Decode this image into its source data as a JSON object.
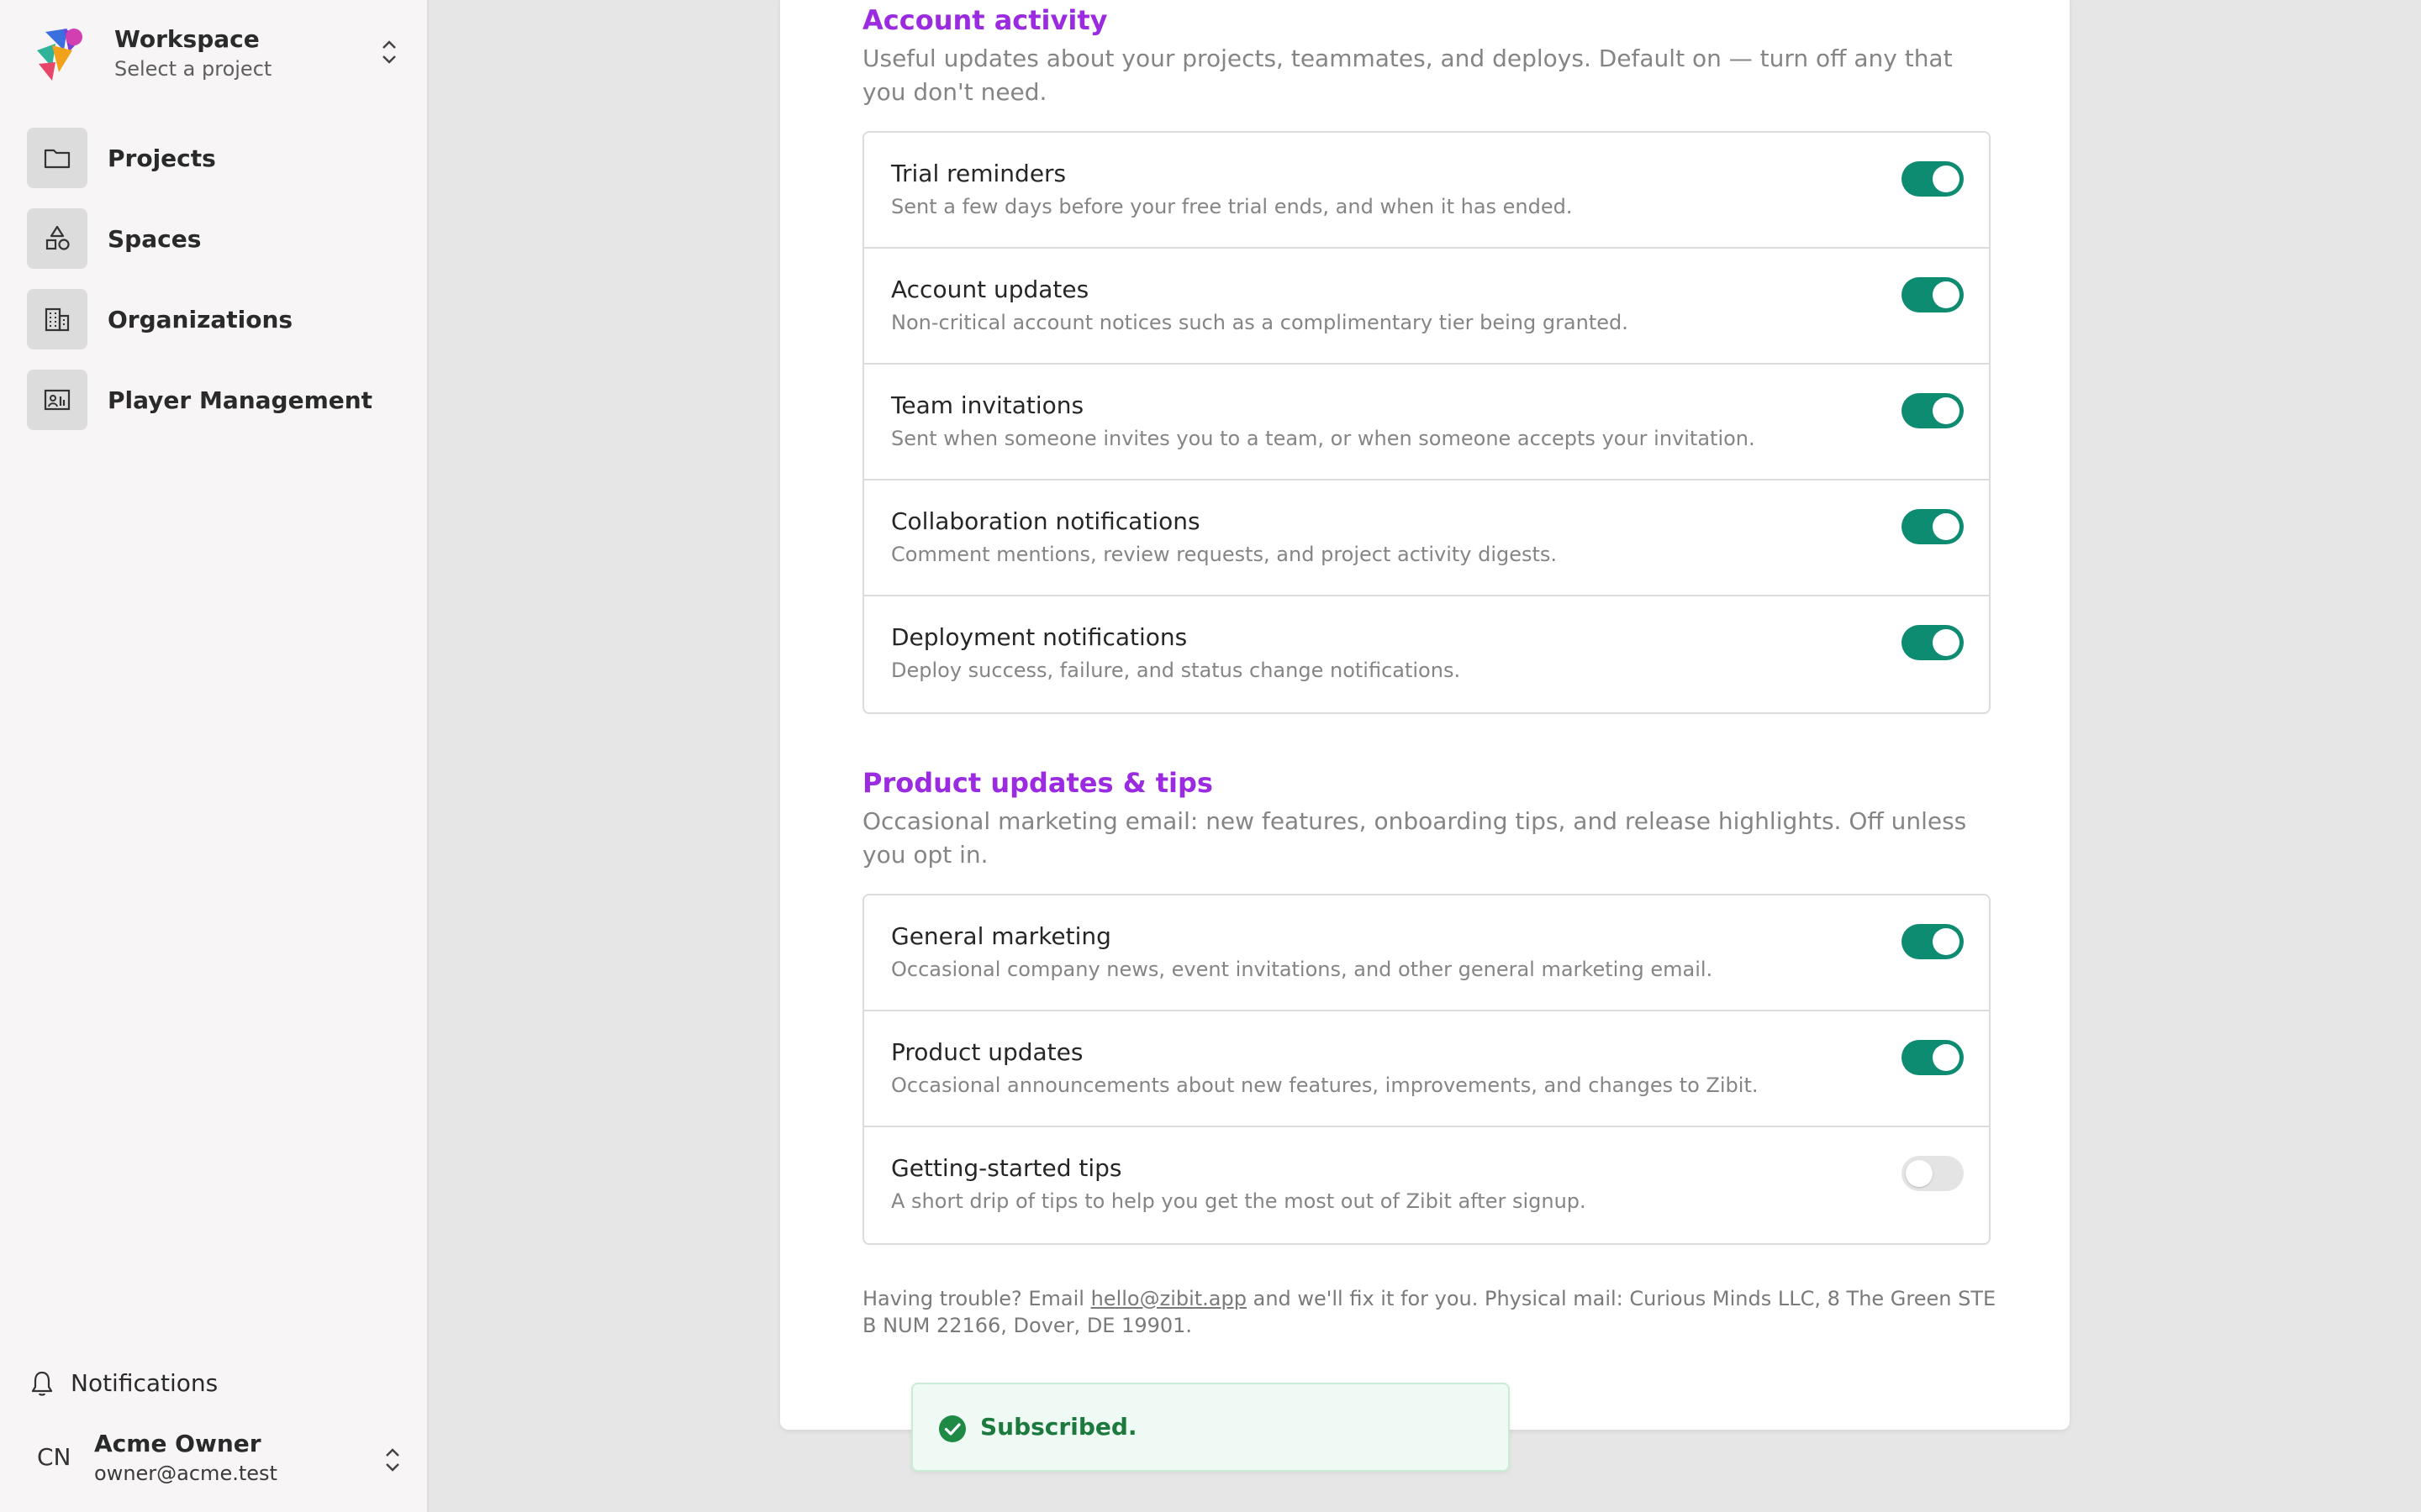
{
  "sidebar": {
    "workspace": {
      "name": "Workspace",
      "subtitle": "Select a project"
    },
    "nav": [
      {
        "label": "Projects",
        "icon": "folder-icon"
      },
      {
        "label": "Spaces",
        "icon": "shapes-icon"
      },
      {
        "label": "Organizations",
        "icon": "building-icon"
      },
      {
        "label": "Player Management",
        "icon": "player-icon"
      }
    ],
    "notifications_label": "Notifications",
    "user": {
      "initials": "CN",
      "name": "Acme Owner",
      "email": "owner@acme.test"
    }
  },
  "account_activity": {
    "title": "Account activity",
    "description": "Useful updates about your projects, teammates, and deploys. Default on — turn off any that you don't need.",
    "items": [
      {
        "title": "Trial reminders",
        "description": "Sent a few days before your free trial ends, and when it has ended.",
        "enabled": true
      },
      {
        "title": "Account updates",
        "description": "Non-critical account notices such as a complimentary tier being granted.",
        "enabled": true
      },
      {
        "title": "Team invitations",
        "description": "Sent when someone invites you to a team, or when someone accepts your invitation.",
        "enabled": true
      },
      {
        "title": "Collaboration notifications",
        "description": "Comment mentions, review requests, and project activity digests.",
        "enabled": true
      },
      {
        "title": "Deployment notifications",
        "description": "Deploy success, failure, and status change notifications.",
        "enabled": true
      }
    ]
  },
  "product_updates": {
    "title": "Product updates & tips",
    "description": "Occasional marketing email: new features, onboarding tips, and release highlights. Off unless you opt in.",
    "items": [
      {
        "title": "General marketing",
        "description": "Occasional company news, event invitations, and other general marketing email.",
        "enabled": true
      },
      {
        "title": "Product updates",
        "description": "Occasional announcements about new features, improvements, and changes to Zibit.",
        "enabled": true
      },
      {
        "title": "Getting-started tips",
        "description": "A short drip of tips to help you get the most out of Zibit after signup.",
        "enabled": false
      }
    ]
  },
  "footer": {
    "prefix": "Having trouble? Email ",
    "email": "hello@zibit.app",
    "suffix": " and we'll fix it for you. Physical mail: Curious Minds LLC, 8 The Green STE B NUM 22166, Dover, DE 19901."
  },
  "toast": {
    "message": "Subscribed.",
    "status": "success"
  },
  "colors": {
    "accent_title": "#9b2be0",
    "toggle_on": "#0e8c72",
    "toast_text": "#1d7a3e"
  }
}
